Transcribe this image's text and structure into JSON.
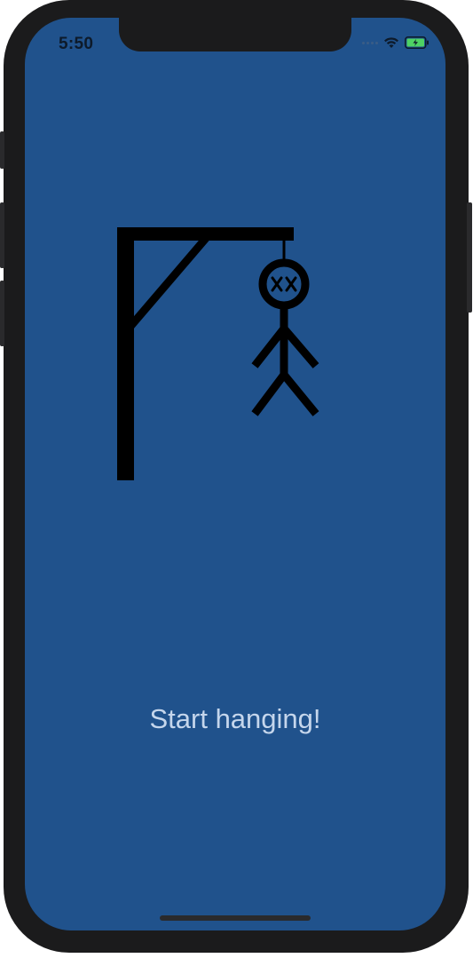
{
  "status_bar": {
    "time": "5:50",
    "icons": [
      "signal-dots-icon",
      "wifi-icon",
      "battery-charging-icon"
    ],
    "battery_color": "#4ed264"
  },
  "game": {
    "figure_icon": "hangman-gallows-with-figure",
    "start_label": "Start hanging!"
  },
  "colors": {
    "background": "#20528c",
    "drawing": "#000000",
    "text": "#c5d6ec"
  }
}
